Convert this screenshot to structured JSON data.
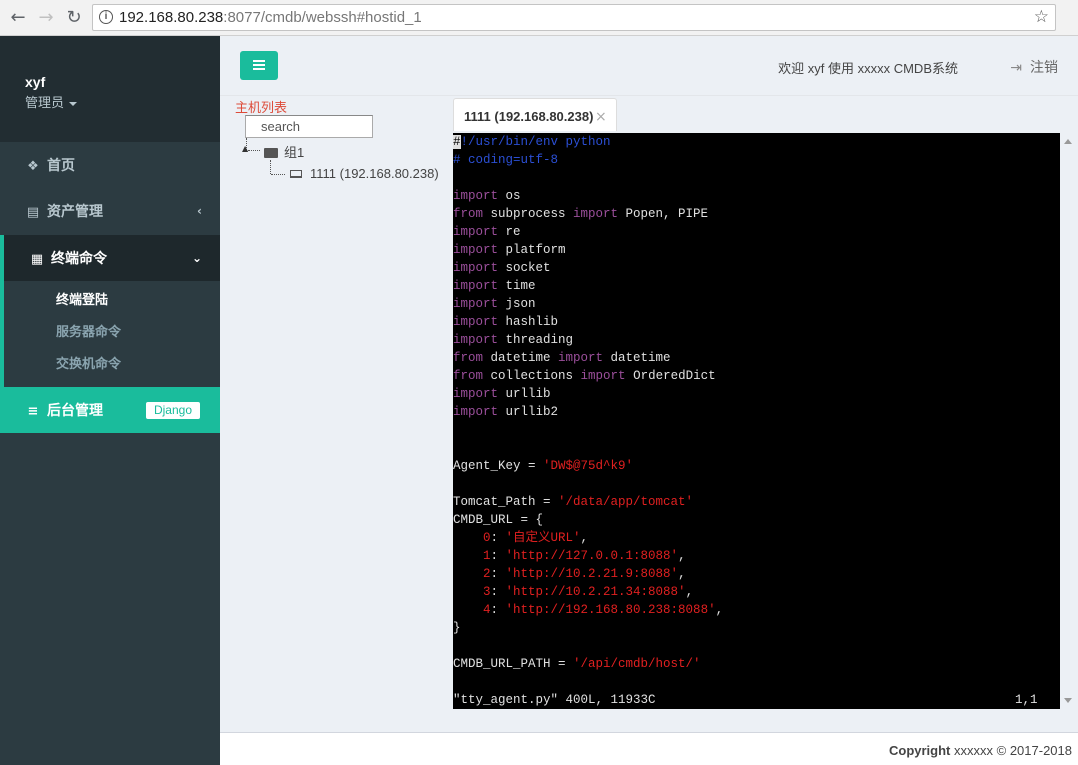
{
  "browser": {
    "url_host": "192.168.80.238",
    "url_path": ":8077/cmdb/webssh#hostid_1",
    "back_icon": "arrow-left-icon",
    "forward_icon": "arrow-right-icon",
    "reload_icon": "reload-icon"
  },
  "sidebar": {
    "user_name": "xyf",
    "user_role": "管理员",
    "items": [
      {
        "label": "首页",
        "icon": "cubes-icon"
      },
      {
        "label": "资产管理",
        "icon": "server-icon"
      },
      {
        "label": "终端命令",
        "icon": "calendar-icon"
      },
      {
        "label": "后台管理",
        "icon": "database-icon",
        "badge": "Django"
      }
    ],
    "sub_items": [
      {
        "label": "终端登陆"
      },
      {
        "label": "服务器命令"
      },
      {
        "label": "交换机命令"
      }
    ]
  },
  "header": {
    "welcome": "欢迎 xyf 使用 xxxxx CMDB系统",
    "logout": "注销"
  },
  "host_panel": {
    "title": "主机列表",
    "search_placeholder": "search",
    "group": "组1",
    "host": "1111 (192.168.80.238)"
  },
  "tab": {
    "label": "1111 (192.168.80.238)",
    "close": "×"
  },
  "terminal": {
    "lines": [
      [
        {
          "t": "#",
          "c": "cursor"
        },
        {
          "t": "!/usr/bin/env python",
          "c": "c-comment"
        }
      ],
      [
        {
          "t": "# coding=utf-8",
          "c": "c-comment"
        }
      ],
      [],
      [
        {
          "t": "import",
          "c": "c-kw"
        },
        {
          "t": " os",
          "c": "c-plain"
        }
      ],
      [
        {
          "t": "from",
          "c": "c-kw"
        },
        {
          "t": " subprocess ",
          "c": "c-plain"
        },
        {
          "t": "import",
          "c": "c-kw"
        },
        {
          "t": " Popen, PIPE",
          "c": "c-plain"
        }
      ],
      [
        {
          "t": "import",
          "c": "c-kw"
        },
        {
          "t": " re",
          "c": "c-plain"
        }
      ],
      [
        {
          "t": "import",
          "c": "c-kw"
        },
        {
          "t": " platform",
          "c": "c-plain"
        }
      ],
      [
        {
          "t": "import",
          "c": "c-kw"
        },
        {
          "t": " socket",
          "c": "c-plain"
        }
      ],
      [
        {
          "t": "import",
          "c": "c-kw"
        },
        {
          "t": " time",
          "c": "c-plain"
        }
      ],
      [
        {
          "t": "import",
          "c": "c-kw"
        },
        {
          "t": " json",
          "c": "c-plain"
        }
      ],
      [
        {
          "t": "import",
          "c": "c-kw"
        },
        {
          "t": " hashlib",
          "c": "c-plain"
        }
      ],
      [
        {
          "t": "import",
          "c": "c-kw"
        },
        {
          "t": " threading",
          "c": "c-plain"
        }
      ],
      [
        {
          "t": "from",
          "c": "c-kw"
        },
        {
          "t": " datetime ",
          "c": "c-plain"
        },
        {
          "t": "import",
          "c": "c-kw"
        },
        {
          "t": " datetime",
          "c": "c-plain"
        }
      ],
      [
        {
          "t": "from",
          "c": "c-kw"
        },
        {
          "t": " collections ",
          "c": "c-plain"
        },
        {
          "t": "import",
          "c": "c-kw"
        },
        {
          "t": " OrderedDict",
          "c": "c-plain"
        }
      ],
      [
        {
          "t": "import",
          "c": "c-kw"
        },
        {
          "t": " urllib",
          "c": "c-plain"
        }
      ],
      [
        {
          "t": "import",
          "c": "c-kw"
        },
        {
          "t": " urllib2",
          "c": "c-plain"
        }
      ],
      [],
      [],
      [
        {
          "t": "Agent_Key = ",
          "c": "c-plain"
        },
        {
          "t": "'DW$@75d^k9'",
          "c": "c-str"
        }
      ],
      [],
      [
        {
          "t": "Tomcat_Path = ",
          "c": "c-plain"
        },
        {
          "t": "'/data/app/tomcat'",
          "c": "c-str"
        }
      ],
      [
        {
          "t": "CMDB_URL = {",
          "c": "c-plain"
        }
      ],
      [
        {
          "t": "    0",
          "c": "c-num"
        },
        {
          "t": ": ",
          "c": "c-plain"
        },
        {
          "t": "'自定义URL'",
          "c": "c-str"
        },
        {
          "t": ",",
          "c": "c-plain"
        }
      ],
      [
        {
          "t": "    1",
          "c": "c-num"
        },
        {
          "t": ": ",
          "c": "c-plain"
        },
        {
          "t": "'http://127.0.0.1:8088'",
          "c": "c-str"
        },
        {
          "t": ",",
          "c": "c-plain"
        }
      ],
      [
        {
          "t": "    2",
          "c": "c-num"
        },
        {
          "t": ": ",
          "c": "c-plain"
        },
        {
          "t": "'http://10.2.21.9:8088'",
          "c": "c-str"
        },
        {
          "t": ",",
          "c": "c-plain"
        }
      ],
      [
        {
          "t": "    3",
          "c": "c-num"
        },
        {
          "t": ": ",
          "c": "c-plain"
        },
        {
          "t": "'http://10.2.21.34:8088'",
          "c": "c-str"
        },
        {
          "t": ",",
          "c": "c-plain"
        }
      ],
      [
        {
          "t": "    4",
          "c": "c-num"
        },
        {
          "t": ": ",
          "c": "c-plain"
        },
        {
          "t": "'http://192.168.80.238:8088'",
          "c": "c-str"
        },
        {
          "t": ",",
          "c": "c-plain"
        }
      ],
      [
        {
          "t": "}",
          "c": "c-plain"
        }
      ],
      [],
      [
        {
          "t": "CMDB_URL_PATH = ",
          "c": "c-plain"
        },
        {
          "t": "'/api/cmdb/host/'",
          "c": "c-str"
        }
      ],
      []
    ],
    "status_left": "\"tty_agent.py\" 400L, 11933C",
    "status_right": "1,1"
  },
  "footer": {
    "copyright_label": "Copyright",
    "copyright_rest": "xxxxxx © 2017-2018"
  },
  "colors": {
    "accent": "#1abc9c",
    "sidebar_bg": "#2c3b41",
    "terminal_bg": "#000000"
  }
}
